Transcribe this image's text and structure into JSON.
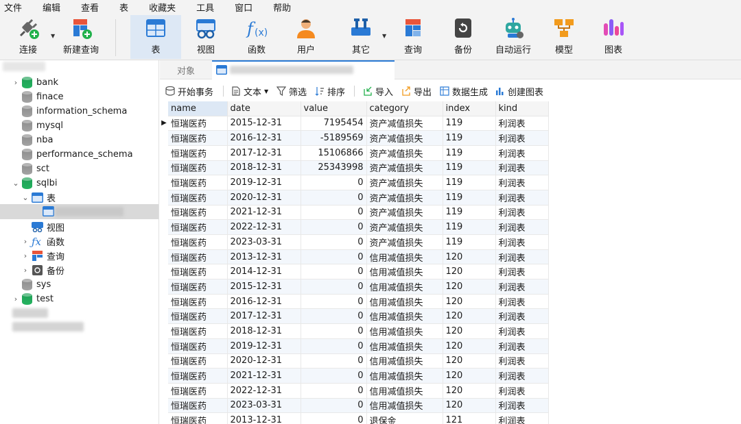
{
  "menu": [
    "文件",
    "编辑",
    "查看",
    "表",
    "收藏夹",
    "工具",
    "窗口",
    "帮助"
  ],
  "toolbar": {
    "buttons": [
      {
        "label": "连接",
        "icon": "plug-icon"
      },
      {
        "label": "新建查询",
        "icon": "new-query-icon"
      },
      {
        "label": "表",
        "icon": "table-icon"
      },
      {
        "label": "视图",
        "icon": "view-icon"
      },
      {
        "label": "函数",
        "icon": "function-icon"
      },
      {
        "label": "用户",
        "icon": "user-icon"
      },
      {
        "label": "其它",
        "icon": "tools-icon"
      },
      {
        "label": "查询",
        "icon": "query-icon"
      },
      {
        "label": "备份",
        "icon": "backup-icon"
      },
      {
        "label": "自动运行",
        "icon": "robot-icon"
      },
      {
        "label": "模型",
        "icon": "model-icon"
      },
      {
        "label": "图表",
        "icon": "chart-icon"
      }
    ]
  },
  "sidebar": {
    "databases": [
      {
        "name": "bank",
        "color": "green",
        "expanded": false
      },
      {
        "name": "finace",
        "color": "gray",
        "expanded": false
      },
      {
        "name": "information_schema",
        "color": "gray",
        "expanded": false
      },
      {
        "name": "mysql",
        "color": "gray",
        "expanded": false
      },
      {
        "name": "nba",
        "color": "gray",
        "expanded": false
      },
      {
        "name": "performance_schema",
        "color": "gray",
        "expanded": false
      },
      {
        "name": "sct",
        "color": "gray",
        "expanded": false
      },
      {
        "name": "sqlbi",
        "color": "green",
        "expanded": true
      },
      {
        "name": "sys",
        "color": "gray",
        "expanded": false
      },
      {
        "name": "test",
        "color": "green",
        "expanded": false
      }
    ],
    "sqlbi_children": [
      "表",
      "视图",
      "函数",
      "查询",
      "备份"
    ]
  },
  "tabs": {
    "objects": "对象"
  },
  "data_toolbar": {
    "begin_transaction": "开始事务",
    "text": "文本",
    "filter": "筛选",
    "sort": "排序",
    "import": "导入",
    "export": "导出",
    "generate_data": "数据生成",
    "create_chart": "创建图表"
  },
  "grid": {
    "columns": [
      "name",
      "date",
      "value",
      "category",
      "index",
      "kind"
    ],
    "rows": [
      [
        "恒瑞医药",
        "2015-12-31",
        "7195454",
        "资产减值损失",
        "119",
        "利润表"
      ],
      [
        "恒瑞医药",
        "2016-12-31",
        "-5189569",
        "资产减值损失",
        "119",
        "利润表"
      ],
      [
        "恒瑞医药",
        "2017-12-31",
        "15106866",
        "资产减值损失",
        "119",
        "利润表"
      ],
      [
        "恒瑞医药",
        "2018-12-31",
        "25343998",
        "资产减值损失",
        "119",
        "利润表"
      ],
      [
        "恒瑞医药",
        "2019-12-31",
        "0",
        "资产减值损失",
        "119",
        "利润表"
      ],
      [
        "恒瑞医药",
        "2020-12-31",
        "0",
        "资产减值损失",
        "119",
        "利润表"
      ],
      [
        "恒瑞医药",
        "2021-12-31",
        "0",
        "资产减值损失",
        "119",
        "利润表"
      ],
      [
        "恒瑞医药",
        "2022-12-31",
        "0",
        "资产减值损失",
        "119",
        "利润表"
      ],
      [
        "恒瑞医药",
        "2023-03-31",
        "0",
        "资产减值损失",
        "119",
        "利润表"
      ],
      [
        "恒瑞医药",
        "2013-12-31",
        "0",
        "信用减值损失",
        "120",
        "利润表"
      ],
      [
        "恒瑞医药",
        "2014-12-31",
        "0",
        "信用减值损失",
        "120",
        "利润表"
      ],
      [
        "恒瑞医药",
        "2015-12-31",
        "0",
        "信用减值损失",
        "120",
        "利润表"
      ],
      [
        "恒瑞医药",
        "2016-12-31",
        "0",
        "信用减值损失",
        "120",
        "利润表"
      ],
      [
        "恒瑞医药",
        "2017-12-31",
        "0",
        "信用减值损失",
        "120",
        "利润表"
      ],
      [
        "恒瑞医药",
        "2018-12-31",
        "0",
        "信用减值损失",
        "120",
        "利润表"
      ],
      [
        "恒瑞医药",
        "2019-12-31",
        "0",
        "信用减值损失",
        "120",
        "利润表"
      ],
      [
        "恒瑞医药",
        "2020-12-31",
        "0",
        "信用减值损失",
        "120",
        "利润表"
      ],
      [
        "恒瑞医药",
        "2021-12-31",
        "0",
        "信用减值损失",
        "120",
        "利润表"
      ],
      [
        "恒瑞医药",
        "2022-12-31",
        "0",
        "信用减值损失",
        "120",
        "利润表"
      ],
      [
        "恒瑞医药",
        "2023-03-31",
        "0",
        "信用减值损失",
        "120",
        "利润表"
      ],
      [
        "恒瑞医药",
        "2013-12-31",
        "0",
        "退保金",
        "121",
        "利润表"
      ]
    ]
  },
  "colors": {
    "accent": "#2a7ad5",
    "db_green": "#1f9d55",
    "db_gray": "#8a8a8a",
    "row_alt": "#f3f7fc"
  }
}
